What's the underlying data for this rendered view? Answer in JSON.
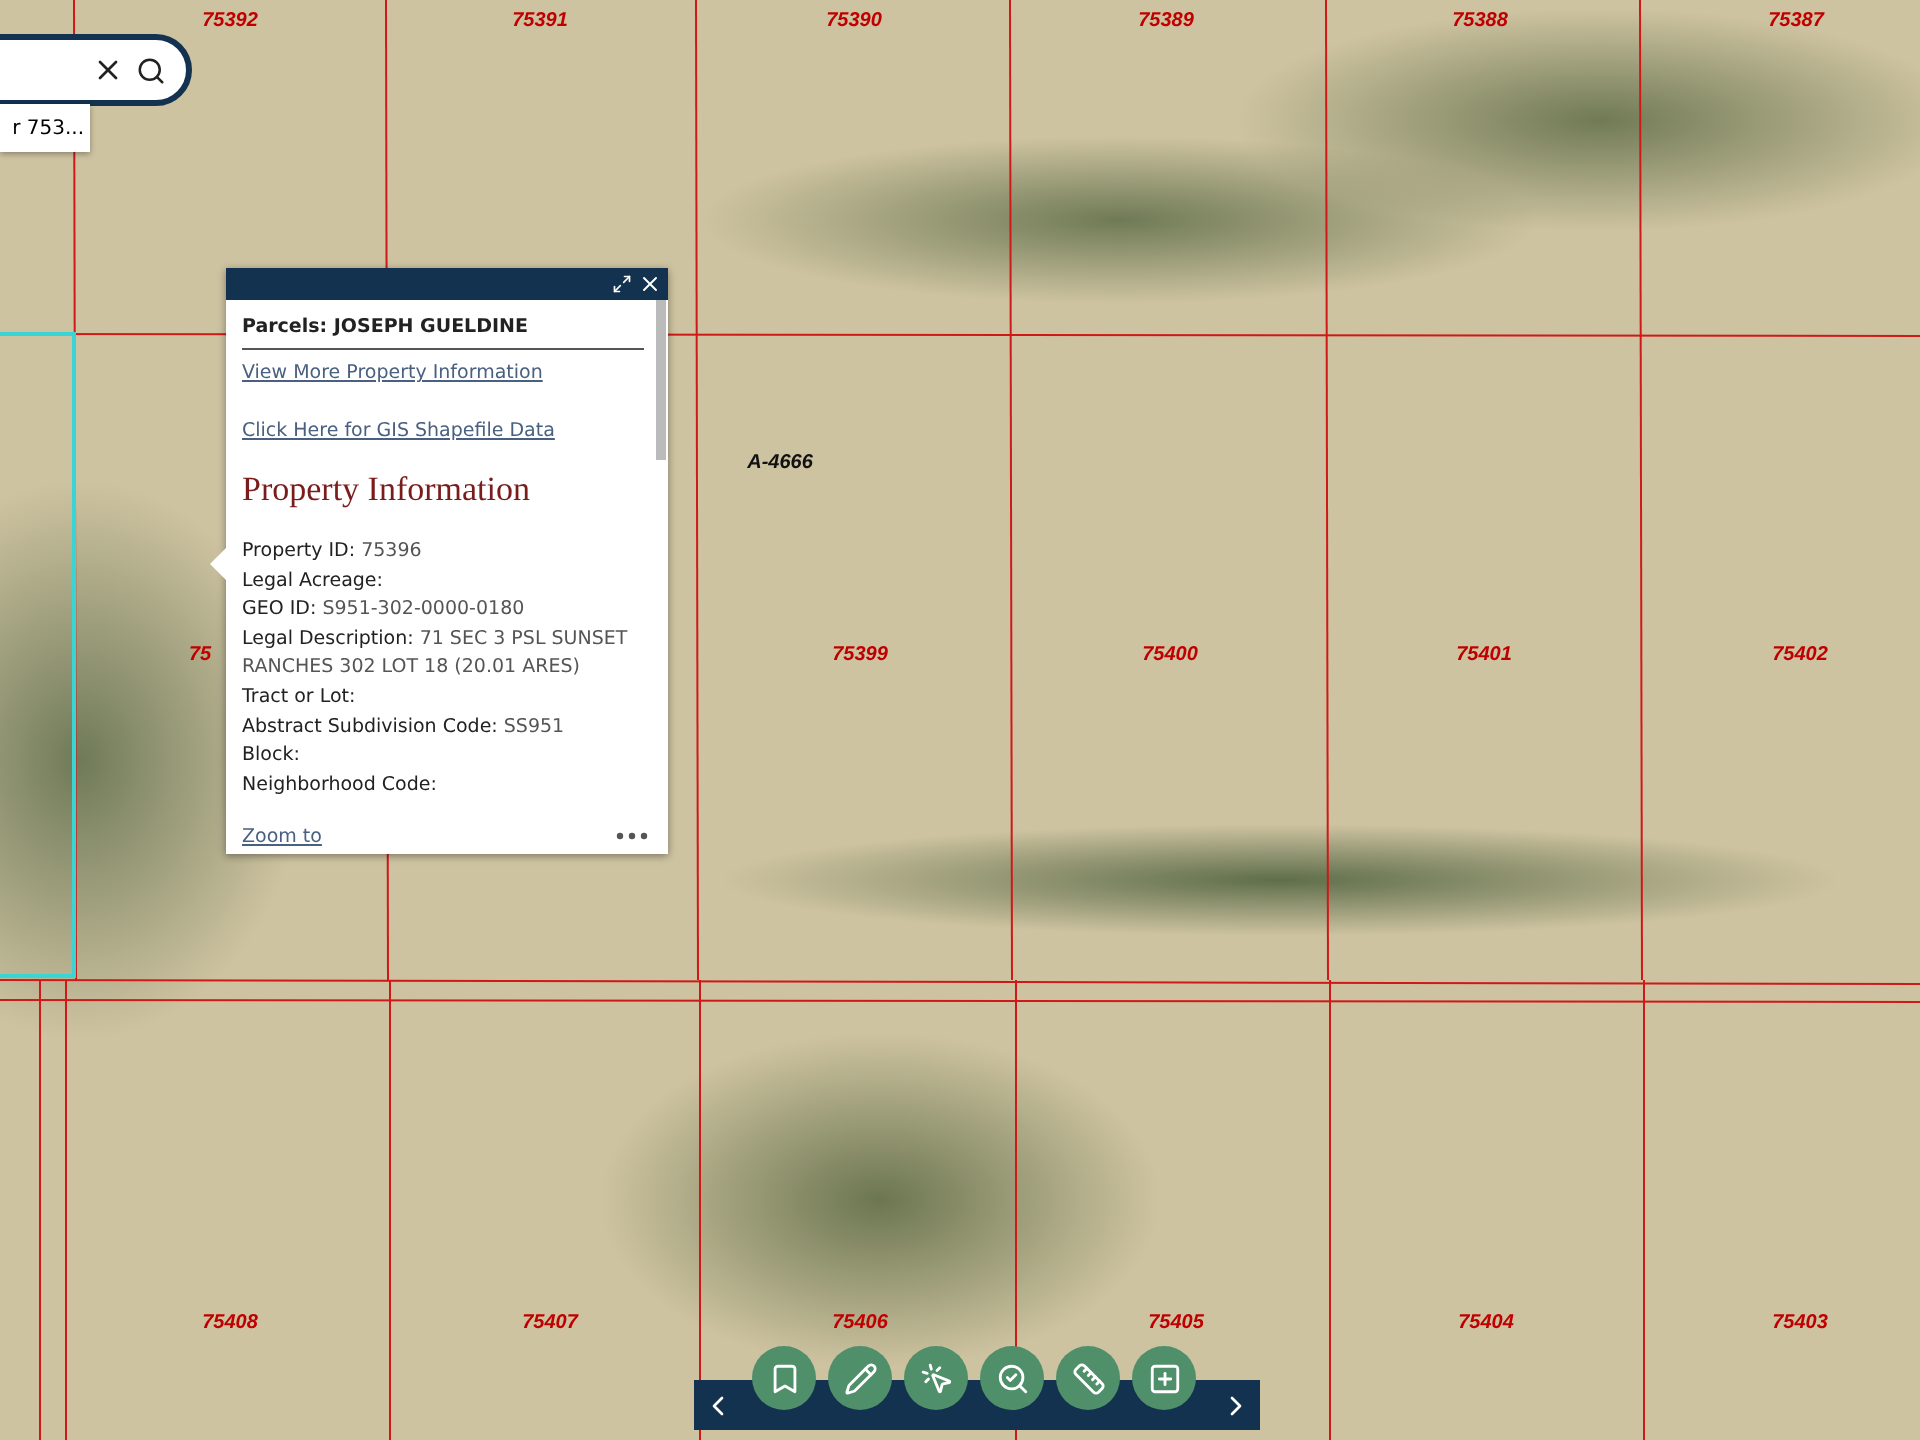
{
  "search": {
    "suggestion": "r 753..."
  },
  "map": {
    "top_labels": [
      "75392",
      "75391",
      "75390",
      "75389",
      "75388",
      "75387"
    ],
    "middle_labels": [
      "75",
      "75399",
      "75400",
      "75401",
      "75402"
    ],
    "bottom_labels": [
      "75408",
      "75407",
      "75406",
      "75405",
      "75404",
      "75403"
    ],
    "abstract_label": "A-4666"
  },
  "popup": {
    "title": "Parcels: JOSEPH GUELDINE",
    "links": [
      "View More Property Information",
      "Click Here for GIS Shapefile Data"
    ],
    "heading": "Property Information",
    "fields": [
      {
        "label": "Property ID:",
        "value": "75396"
      },
      {
        "label": "Legal Acreage:"
      },
      {
        "label": "GEO ID:",
        "value": "S951-302-0000-0180"
      },
      {
        "label": "Legal Description:",
        "value": "71 SEC 3 PSL SUNSET RANCHES 302 LOT 18 (20.01 ARES)"
      },
      {
        "label": "Tract or Lot:"
      },
      {
        "label": "Abstract Subdivision Code:",
        "value": "SS951"
      },
      {
        "label": "Block:"
      },
      {
        "label": "Neighborhood Code:"
      }
    ],
    "footer_link": "Zoom to"
  },
  "toolbar": {
    "tools": [
      {
        "kind": "bookmark"
      },
      {
        "kind": "draw"
      },
      {
        "kind": "select"
      },
      {
        "kind": "query"
      },
      {
        "kind": "measure"
      },
      {
        "kind": "add-layer"
      }
    ]
  }
}
